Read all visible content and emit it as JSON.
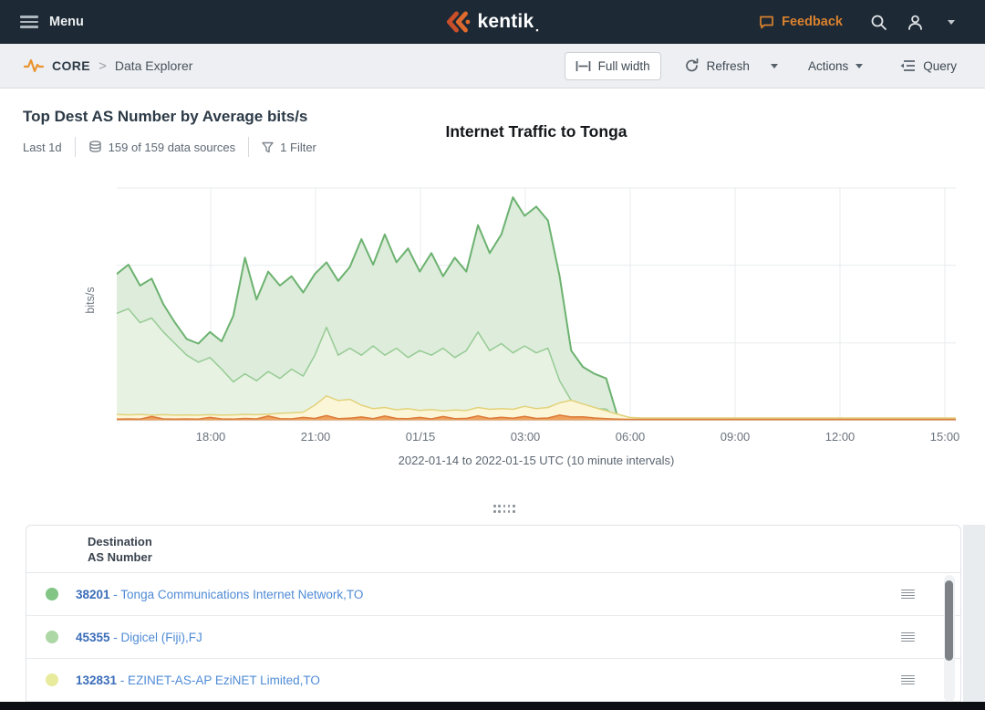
{
  "navbar": {
    "menu_label": "Menu",
    "brand": "kentik",
    "feedback_label": "Feedback"
  },
  "toolbar": {
    "section": "CORE",
    "separator": ">",
    "page": "Data Explorer",
    "full_width_label": "Full width",
    "refresh_label": "Refresh",
    "actions_label": "Actions",
    "query_label": "Query"
  },
  "panel": {
    "title": "Top Dest AS Number by Average bits/s",
    "time_range": "Last 1d",
    "data_sources": "159 of 159 data sources",
    "filters": "1 Filter"
  },
  "chart_data": {
    "type": "area",
    "stacked": true,
    "title": "Internet Traffic to Tonga",
    "ylabel": "bits/s",
    "xlabel": "2022-01-14 to 2022-01-15 UTC (10 minute intervals)",
    "grid": true,
    "legend_position": "table-below",
    "x_range": "2022-01-14 ~15:20 UTC to 2022-01-15 ~15:20 UTC",
    "interval": "10 minutes",
    "x_ticks": [
      {
        "label": "18:00",
        "pos": 0.112
      },
      {
        "label": "21:00",
        "pos": 0.237
      },
      {
        "label": "01/15",
        "pos": 0.362
      },
      {
        "label": "03:00",
        "pos": 0.487
      },
      {
        "label": "06:00",
        "pos": 0.612
      },
      {
        "label": "09:00",
        "pos": 0.737
      },
      {
        "label": "12:00",
        "pos": 0.862
      },
      {
        "label": "15:00",
        "pos": 0.987
      }
    ],
    "y_axis_note": "no numeric tick labels shown; values below are percent of plot height (stacked band tops); traffic drops to near zero ~05:30 UTC after cable cut",
    "series": [
      {
        "name": "38201 - Tonga Communications Internet Network,TO",
        "stroke": "#6cb270",
        "fill": "#ddecdb",
        "values": [
          63,
          67,
          58,
          61,
          50,
          42,
          35,
          33,
          38,
          34,
          45,
          70,
          52,
          64,
          58,
          62,
          55,
          63,
          68,
          60,
          66,
          78,
          67,
          80,
          68,
          74,
          64,
          72,
          62,
          70,
          64,
          84,
          72,
          80,
          96,
          88,
          92,
          86,
          62,
          30,
          23,
          20,
          18,
          1.2,
          0.6,
          0.6,
          0.6,
          0.6,
          0.6,
          0.6,
          0.6,
          0.6,
          0.6,
          0.6,
          0.6,
          0.6,
          0.6,
          0.6,
          0.6,
          0.6,
          0.6,
          0.6,
          0.6,
          0.6,
          0.6,
          0.6,
          0.6,
          0.6,
          0.6,
          0.6,
          0.6,
          0.6,
          0.6
        ]
      },
      {
        "name": "45355 - Digicel (Fiji),FJ",
        "stroke": "#97cb94",
        "fill": "#e7f2e3",
        "values": [
          46,
          48,
          42,
          44,
          38,
          33,
          28,
          25,
          27,
          22,
          16.5,
          20,
          17,
          21,
          18,
          22,
          19,
          28,
          40,
          28,
          31,
          28,
          32,
          28,
          31,
          27,
          30,
          28,
          31,
          27,
          30,
          38,
          30,
          33,
          29,
          32,
          29,
          31,
          17,
          8.5,
          5.5,
          5,
          4.8,
          0.8,
          0.5,
          0.5,
          0.5,
          0.5,
          0.5,
          0.5,
          0.5,
          0.5,
          0.5,
          0.5,
          0.5,
          0.5,
          0.5,
          0.5,
          0.5,
          0.5,
          0.5,
          0.5,
          0.5,
          0.5,
          0.5,
          0.5,
          0.5,
          0.5,
          0.5,
          0.5,
          0.5,
          0.5,
          0.5
        ]
      },
      {
        "name": "132831 - EZINET-AS-AP EziNET Limited,TO",
        "stroke": "#e2d27b",
        "fill": "#fbf6d8",
        "values": [
          2.5,
          2.3,
          2.5,
          2.2,
          2.4,
          2.2,
          2.3,
          2.2,
          2.4,
          2.2,
          2.3,
          2.5,
          2.4,
          2.6,
          3,
          3.2,
          3.5,
          6.5,
          10.5,
          8.5,
          9,
          6.5,
          5,
          5.5,
          4.5,
          5,
          4.2,
          4.6,
          4,
          4.4,
          4.2,
          5.5,
          4.7,
          5,
          4.7,
          6,
          5,
          5.5,
          7.5,
          8.6,
          7,
          5.5,
          4,
          2.6,
          1.2,
          1,
          1,
          1,
          1,
          1,
          1,
          1,
          1,
          1,
          1,
          1,
          1,
          1,
          1,
          1,
          1,
          1,
          1,
          1,
          1,
          1,
          1,
          1,
          1,
          1,
          1,
          1,
          1
        ]
      },
      {
        "name": "",
        "stroke": "#dd7b38",
        "fill": "#eda express05c",
        "values": [
          0.5,
          0.6,
          0.5,
          1.6,
          0.6,
          0.5,
          0.6,
          0.5,
          1.2,
          0.6,
          0.5,
          0.8,
          0.6,
          1.8,
          0.7,
          0.6,
          1.2,
          0.8,
          2,
          0.7,
          0.9,
          1.4,
          0.7,
          1.8,
          0.8,
          0.7,
          1.2,
          0.6,
          1.6,
          0.7,
          0.8,
          1.9,
          0.8,
          1.3,
          0.9,
          1.7,
          0.8,
          1,
          2.2,
          1.4,
          1.5,
          1,
          0.7,
          0.5,
          0.4,
          0.4,
          0.4,
          0.4,
          0.4,
          0.4,
          0.4,
          0.4,
          0.4,
          0.4,
          0.4,
          0.4,
          0.4,
          0.4,
          0.4,
          0.4,
          0.4,
          0.4,
          0.4,
          0.4,
          0.4,
          0.4,
          0.4,
          0.4,
          0.4,
          0.4,
          0.4,
          0.4,
          0.4
        ]
      }
    ]
  },
  "table": {
    "header_line1": "Destination",
    "header_line2": "AS Number",
    "rows": [
      {
        "dot_color": "#82c585",
        "as_number": "38201",
        "description": " - Tonga Communications Internet Network,TO"
      },
      {
        "dot_color": "#aed7a6",
        "as_number": "45355",
        "description": " - Digicel (Fiji),FJ"
      },
      {
        "dot_color": "#e7eb9b",
        "as_number": "132831",
        "description": " - EZINET-AS-AP EziNET Limited,TO"
      }
    ]
  }
}
